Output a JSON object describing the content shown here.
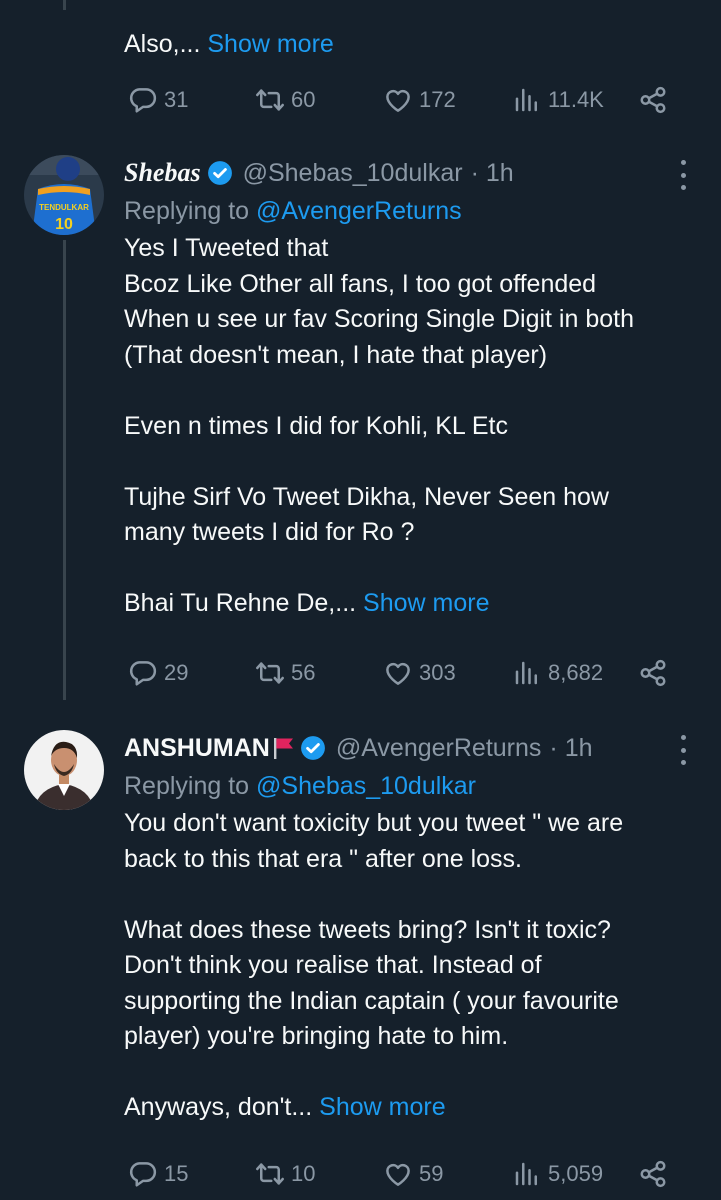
{
  "fragment": {
    "text": "Also,... ",
    "show_more": "Show more",
    "stats": {
      "replies": "31",
      "retweets": "60",
      "likes": "172",
      "views": "11.4K"
    }
  },
  "tweets": [
    {
      "name": "Shebas",
      "handle": "@Shebas_10dulkar",
      "time": "· 1h",
      "replying_label": "Replying to ",
      "replying_to": "@AvengerReturns",
      "text": "Yes I Tweeted that\nBcoz Like Other all fans, I too got offended\nWhen u see ur fav Scoring Single Digit in both\n(That doesn't mean, I hate that player)\n\nEven n times I did for Kohli, KL Etc\n\nTujhe Sirf Vo Tweet Dikha, Never Seen how\nmany tweets I did for Ro ?\n\nBhai Tu Rehne De,... ",
      "show_more": "Show more",
      "avatar_text": "TENDULKAR",
      "avatar_number": "10",
      "stats": {
        "replies": "29",
        "retweets": "56",
        "likes": "303",
        "views": "8,682"
      }
    },
    {
      "name": "ANSHUMAN",
      "handle": "@AvengerReturns",
      "time": "· 1h",
      "replying_label": "Replying to ",
      "replying_to": "@Shebas_10dulkar",
      "text": "You don't want toxicity but you tweet \" we are\nback to this that era \" after one loss.\n\nWhat does these tweets bring? Isn't it toxic?\nDon't think you realise that. Instead of\nsupporting the Indian captain ( your favourite\nplayer) you're bringing hate to him.\n\nAnyways, don't... ",
      "show_more": "Show more",
      "stats": {
        "replies": "15",
        "retweets": "10",
        "likes": "59",
        "views": "5,059"
      }
    }
  ],
  "colors": {
    "background": "#15202b",
    "accent": "#1d9bf0",
    "muted": "#8b98a5",
    "flag": "#e0245e"
  }
}
